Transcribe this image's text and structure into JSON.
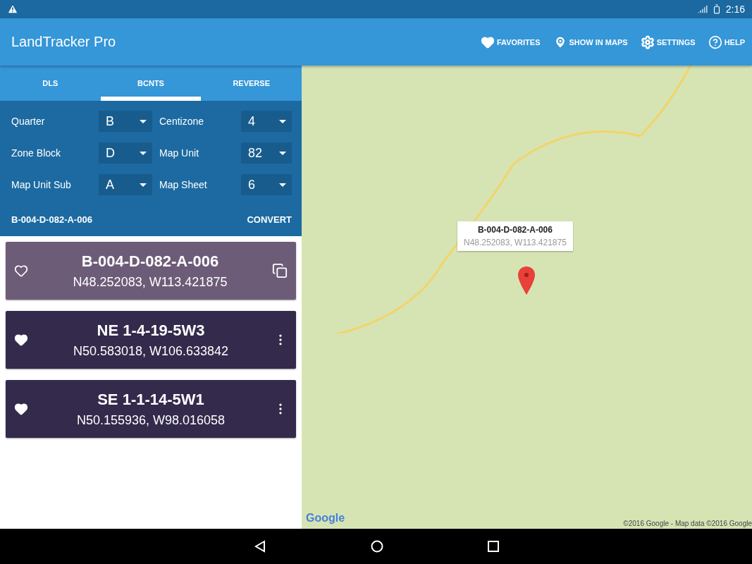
{
  "status_bar": {
    "time": "2:16"
  },
  "app_bar": {
    "title": "LandTracker Pro",
    "actions": [
      {
        "kind": "favorites",
        "label": "FAVORITES"
      },
      {
        "kind": "maps",
        "label": "SHOW IN MAPS"
      },
      {
        "kind": "settings",
        "label": "SETTINGS"
      },
      {
        "kind": "help",
        "label": "HELP"
      }
    ]
  },
  "tabs": [
    {
      "label": "DLS",
      "selected": false
    },
    {
      "label": "BCNTS",
      "selected": true
    },
    {
      "label": "REVERSE",
      "selected": false
    }
  ],
  "form": {
    "fields": [
      {
        "label": "Quarter",
        "value": "B"
      },
      {
        "label": "Centizone",
        "value": "4"
      },
      {
        "label": "Zone Block",
        "value": "D"
      },
      {
        "label": "Map Unit",
        "value": "82"
      },
      {
        "label": "Map Unit Sub",
        "value": "A"
      },
      {
        "label": "Map Sheet",
        "value": "6"
      }
    ],
    "result": "B-004-D-082-A-006",
    "convert": "CONVERT"
  },
  "results": [
    {
      "title": "B-004-D-082-A-006",
      "coords": "N48.252083, W113.421875",
      "favorite": false,
      "selected": true
    },
    {
      "title": "NE 1-4-19-5W3",
      "coords": "N50.583018, W106.633842",
      "favorite": true,
      "selected": false
    },
    {
      "title": "SE 1-1-14-5W1",
      "coords": "N50.155936, W98.016058",
      "favorite": true,
      "selected": false
    }
  ],
  "map": {
    "callout": {
      "title": "B-004-D-082-A-006",
      "coords": "N48.252083, W113.421875"
    },
    "logo": "Google",
    "attribution": "©2016 Google - Map data ©2016 Google"
  }
}
